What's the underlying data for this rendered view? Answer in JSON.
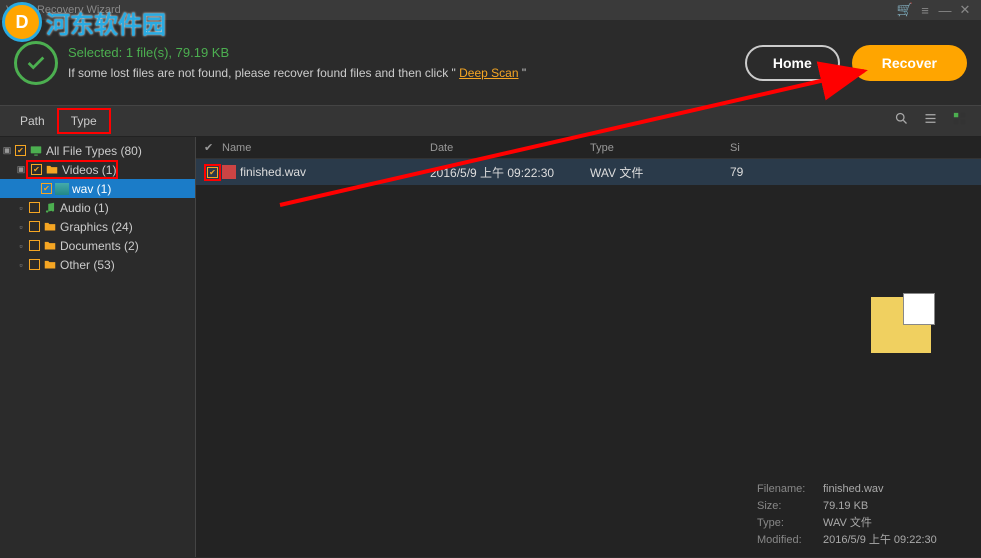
{
  "titlebar": {
    "title": "Video Recovery Wizard"
  },
  "watermark": {
    "logo": "D",
    "text": "河东软件园"
  },
  "header": {
    "selected": "Selected: 1 file(s), 79.19 KB",
    "hint_before": "If some lost files are not found, please recover found files and then click \" ",
    "deep_scan": "Deep Scan",
    "hint_after": " \"",
    "home": "Home",
    "recover": "Recover"
  },
  "tabs": {
    "path": "Path",
    "type": "Type"
  },
  "tree": {
    "all": "All File Types (80)",
    "videos": "Videos (1)",
    "wav": "wav (1)",
    "audio": "Audio (1)",
    "graphics": "Graphics (24)",
    "documents": "Documents (2)",
    "other": "Other (53)"
  },
  "columns": {
    "name": "Name",
    "date": "Date",
    "type": "Type",
    "size": "Si"
  },
  "file": {
    "name": "finished.wav",
    "date": "2016/5/9 上午 09:22:30",
    "type": "WAV 文件",
    "size": "79"
  },
  "info": {
    "filename_k": "Filename:",
    "filename_v": "finished.wav",
    "size_k": "Size:",
    "size_v": "79.19 KB",
    "type_k": "Type:",
    "type_v": "WAV 文件",
    "modified_k": "Modified:",
    "modified_v": "2016/5/9 上午 09:22:30"
  }
}
